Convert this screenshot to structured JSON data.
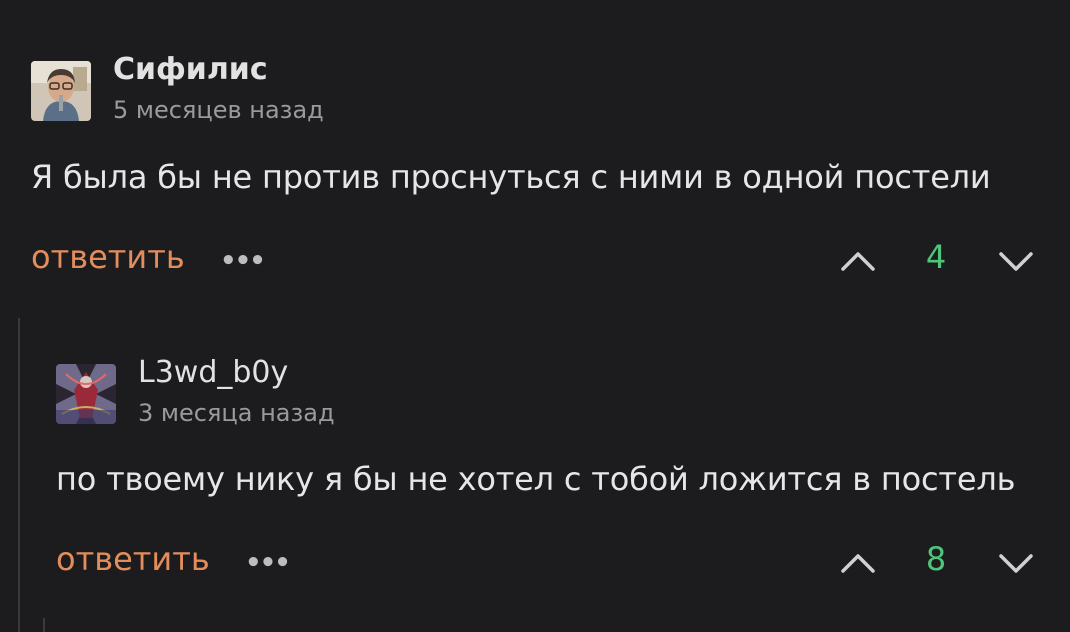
{
  "comments": [
    {
      "username": "Сифилис",
      "time": "5 месяцев назад",
      "text": "Я была бы не против проснуться с ними в одной постели",
      "reply_label": "ответить",
      "more_label": "•••",
      "votes": "4"
    },
    {
      "username": "L3wd_b0y",
      "time": "3 месяца назад",
      "text": "по твоему нику я бы не хотел с тобой ложится в постель",
      "reply_label": "ответить",
      "more_label": "•••",
      "votes": "8"
    }
  ],
  "colors": {
    "background": "#1c1c1e",
    "reply_link": "#e38d5c",
    "vote_count": "#4fc57a",
    "thread_line": "#3a3a3c"
  },
  "icons": {
    "upvote": "chevron-up-icon",
    "downvote": "chevron-down-icon",
    "more": "more-dots-icon"
  }
}
